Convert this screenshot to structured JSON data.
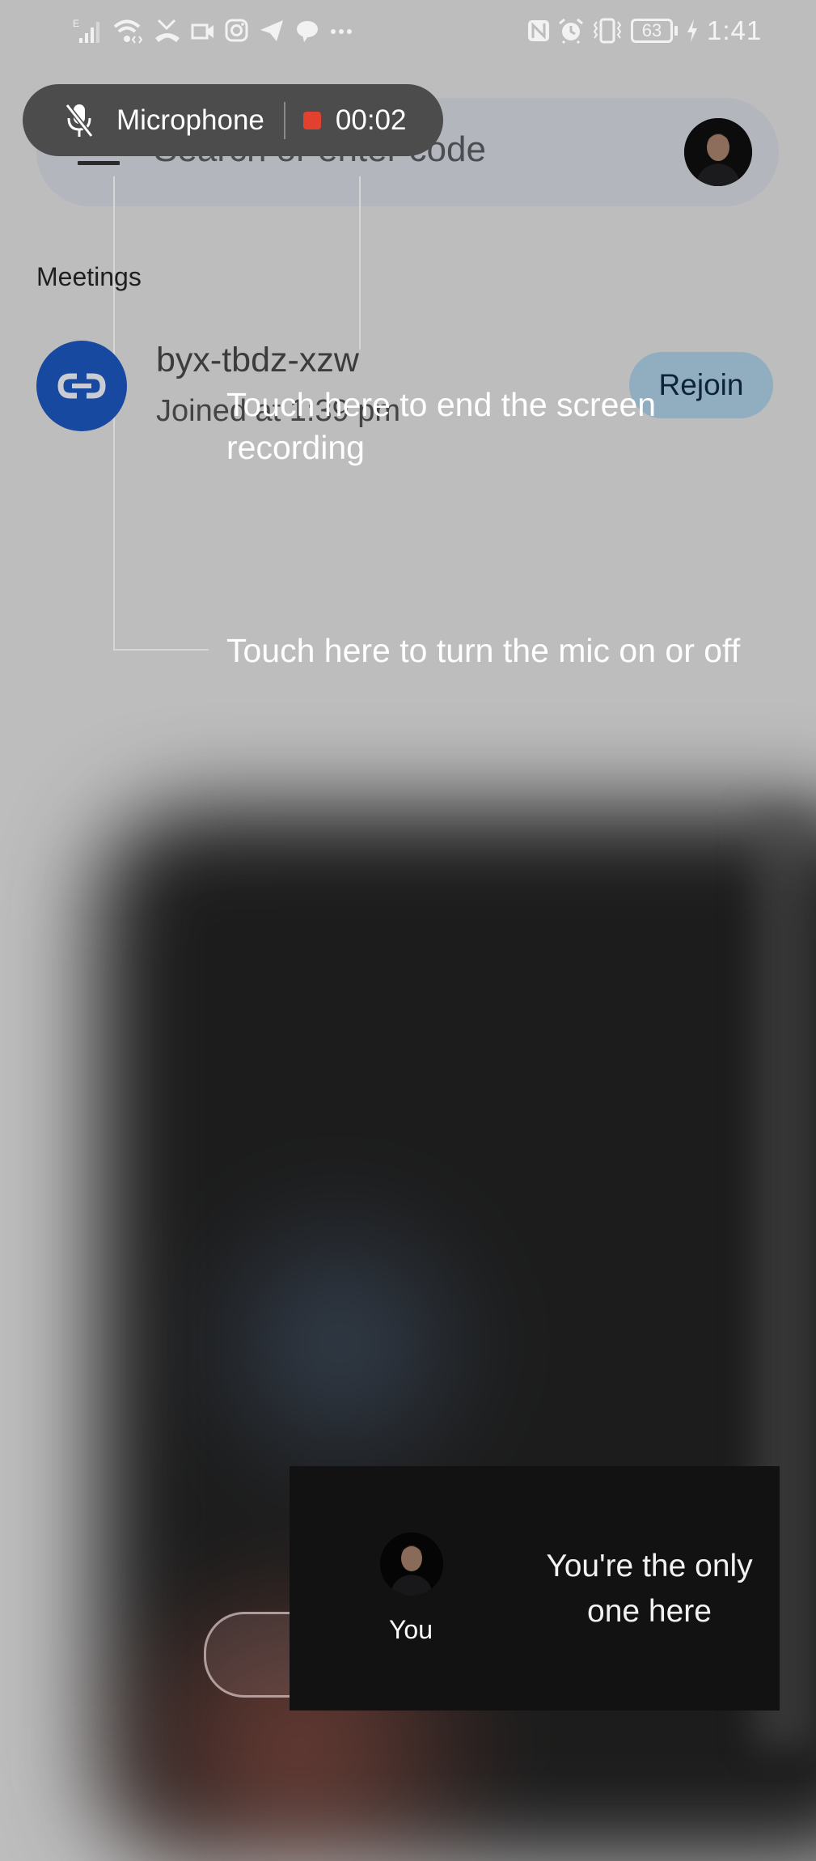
{
  "status_bar": {
    "network_type": "E",
    "left_icons": [
      "signal-icon",
      "wifi-icon",
      "missed-call-icon",
      "video-camera-icon",
      "instagram-icon",
      "telegram-icon",
      "chat-bubble-icon",
      "more-notifications-icon"
    ],
    "right_icons": [
      "nfc-icon",
      "alarm-icon",
      "vibrate-icon",
      "battery-icon",
      "charging-icon"
    ],
    "battery_level": "63",
    "time": "1:41"
  },
  "recording_pill": {
    "mic_label": "Microphone",
    "elapsed": "00:02",
    "stop_color": "#e2412f"
  },
  "search": {
    "placeholder": "Search or enter code"
  },
  "meetings": {
    "section_title": "Meetings",
    "items": [
      {
        "code": "byx-tbdz-xzw",
        "subtitle": "Joined at 1:39 pm",
        "action_label": "Rejoin",
        "icon": "link-icon",
        "icon_bg": "#1749a0"
      }
    ]
  },
  "hints": {
    "end_recording": "Touch here to end the screen recording",
    "toggle_mic": "Touch here to turn the mic on or off"
  },
  "self_view": {
    "label": "You",
    "message": "You're the only one here"
  }
}
